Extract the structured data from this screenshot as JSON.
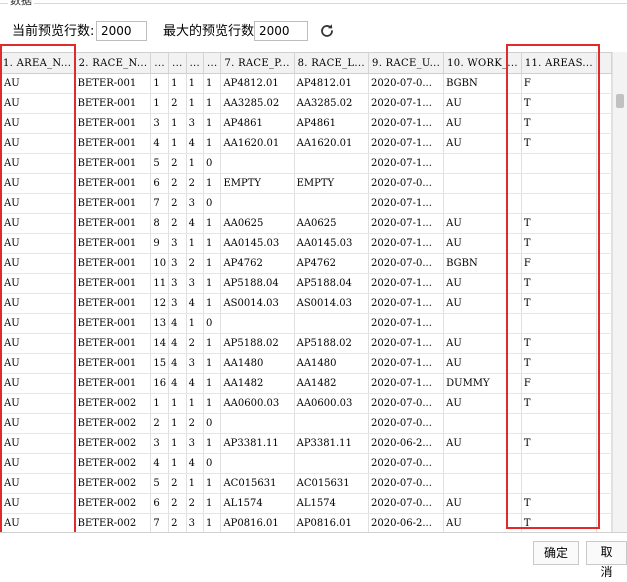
{
  "group_title": "数据",
  "toolbar": {
    "preview_rows_label": "当前预览行数:",
    "preview_rows_value": "2000",
    "max_rows_label": "最大的预览行数:",
    "max_rows_value": "2000",
    "refresh_icon": "refresh-icon"
  },
  "grid": {
    "columns": [
      "1. AREA_N...",
      "2. RACE_N...",
      "...",
      "...",
      "...",
      "...",
      "7. RACE_P...",
      "8. RACE_L...",
      "9. RACE_U...",
      "10. WORK_...",
      "11. AREAS..."
    ],
    "rows": [
      [
        "AU",
        "BETER-001",
        "1",
        "1",
        "1",
        "1",
        "AP4812.01",
        "AP4812.01",
        "2020-07-0...",
        "BGBN",
        "F"
      ],
      [
        "AU",
        "BETER-001",
        "1",
        "2",
        "1",
        "1",
        "AA3285.02",
        "AA3285.02",
        "2020-07-1...",
        "AU",
        "T"
      ],
      [
        "AU",
        "BETER-001",
        "3",
        "1",
        "3",
        "1",
        "AP4861",
        "AP4861",
        "2020-07-1...",
        "AU",
        "T"
      ],
      [
        "AU",
        "BETER-001",
        "4",
        "1",
        "4",
        "1",
        "AA1620.01",
        "AA1620.01",
        "2020-07-1...",
        "AU",
        "T"
      ],
      [
        "AU",
        "BETER-001",
        "5",
        "2",
        "1",
        "0",
        "",
        "",
        "2020-07-1...",
        "",
        ""
      ],
      [
        "AU",
        "BETER-001",
        "6",
        "2",
        "2",
        "1",
        "EMPTY",
        "EMPTY",
        "2020-07-0...",
        "",
        ""
      ],
      [
        "AU",
        "BETER-001",
        "7",
        "2",
        "3",
        "0",
        "",
        "",
        "2020-07-1...",
        "",
        ""
      ],
      [
        "AU",
        "BETER-001",
        "8",
        "2",
        "4",
        "1",
        "AA0625",
        "AA0625",
        "2020-07-1...",
        "AU",
        "T"
      ],
      [
        "AU",
        "BETER-001",
        "9",
        "3",
        "1",
        "1",
        "AA0145.03",
        "AA0145.03",
        "2020-07-1...",
        "AU",
        "T"
      ],
      [
        "AU",
        "BETER-001",
        "10",
        "3",
        "2",
        "1",
        "AP4762",
        "AP4762",
        "2020-07-0...",
        "BGBN",
        "F"
      ],
      [
        "AU",
        "BETER-001",
        "11",
        "3",
        "3",
        "1",
        "AP5188.04",
        "AP5188.04",
        "2020-07-1...",
        "AU",
        "T"
      ],
      [
        "AU",
        "BETER-001",
        "12",
        "3",
        "4",
        "1",
        "AS0014.03",
        "AS0014.03",
        "2020-07-1...",
        "AU",
        "T"
      ],
      [
        "AU",
        "BETER-001",
        "13",
        "4",
        "1",
        "0",
        "",
        "",
        "2020-07-1...",
        "",
        ""
      ],
      [
        "AU",
        "BETER-001",
        "14",
        "4",
        "2",
        "1",
        "AP5188.02",
        "AP5188.02",
        "2020-07-1...",
        "AU",
        "T"
      ],
      [
        "AU",
        "BETER-001",
        "15",
        "4",
        "3",
        "1",
        "AA1480",
        "AA1480",
        "2020-07-1...",
        "AU",
        "T"
      ],
      [
        "AU",
        "BETER-001",
        "16",
        "4",
        "4",
        "1",
        "AA1482",
        "AA1482",
        "2020-07-1...",
        "DUMMY",
        "F"
      ],
      [
        "AU",
        "BETER-002",
        "1",
        "1",
        "1",
        "1",
        "AA0600.03",
        "AA0600.03",
        "2020-07-0...",
        "AU",
        "T"
      ],
      [
        "AU",
        "BETER-002",
        "2",
        "1",
        "2",
        "0",
        "",
        "",
        "2020-07-0...",
        "",
        ""
      ],
      [
        "AU",
        "BETER-002",
        "3",
        "1",
        "3",
        "1",
        "AP3381.11",
        "AP3381.11",
        "2020-06-2...",
        "AU",
        "T"
      ],
      [
        "AU",
        "BETER-002",
        "4",
        "1",
        "4",
        "0",
        "",
        "",
        "2020-07-0...",
        "",
        ""
      ],
      [
        "AU",
        "BETER-002",
        "5",
        "2",
        "1",
        "1",
        "AC015631",
        "AC015631",
        "2020-07-0...",
        "",
        ""
      ],
      [
        "AU",
        "BETER-002",
        "6",
        "2",
        "2",
        "1",
        "AL1574",
        "AL1574",
        "2020-07-0...",
        "AU",
        "T"
      ],
      [
        "AU",
        "BETER-002",
        "7",
        "2",
        "3",
        "1",
        "AP0816.01",
        "AP0816.01",
        "2020-06-2...",
        "AU",
        "T"
      ]
    ]
  },
  "footer": {
    "ok_label": "确定",
    "cancel_label": "取消"
  },
  "colors": {
    "highlight": "#e12b2b",
    "header_bg": "#f2f2f2"
  }
}
